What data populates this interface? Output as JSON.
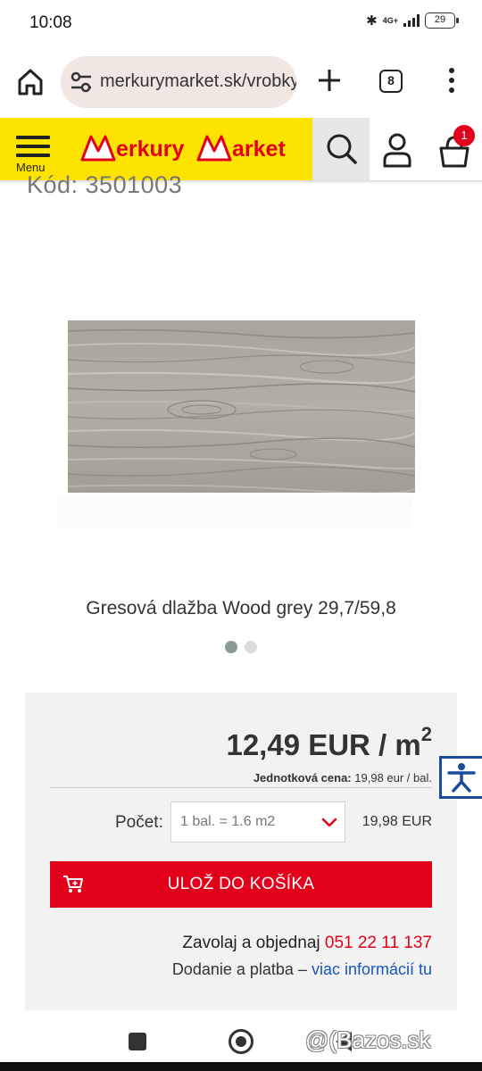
{
  "status_bar": {
    "time": "10:08",
    "network": "4G+",
    "battery": "29"
  },
  "browser": {
    "url": "merkurymarket.sk/vrobky",
    "tab_count": "8"
  },
  "site_header": {
    "menu_label": "Menu",
    "logo_text": "Merkury Market",
    "cart_count": "1",
    "colors": {
      "brand_yellow": "#fde400",
      "brand_red": "#e3001b"
    }
  },
  "product": {
    "code": "Kód: 3501003",
    "title": "Gresová dlažba Wood grey 29,7/59,8",
    "gallery_count": 2,
    "gallery_active": 1
  },
  "purchase": {
    "price": "12,49 EUR / m",
    "price_exp": "2",
    "unit_price_label": "Jednotková cena:",
    "unit_price_value": "19,98 eur / bal.",
    "qty_label": "Počet:",
    "qty_selected": "1 bal. = 1.6 m2",
    "qty_total": "19,98 EUR",
    "add_to_cart_label": "ULOŽ DO KOŠÍKA",
    "call_text": "Zavolaj a objednaj",
    "phone": "051 22 11 137",
    "delivery_text": "Dodanie a platba –",
    "delivery_link": "viac informácií tu"
  },
  "system": {
    "watermark": "@(Bazos.sk"
  }
}
